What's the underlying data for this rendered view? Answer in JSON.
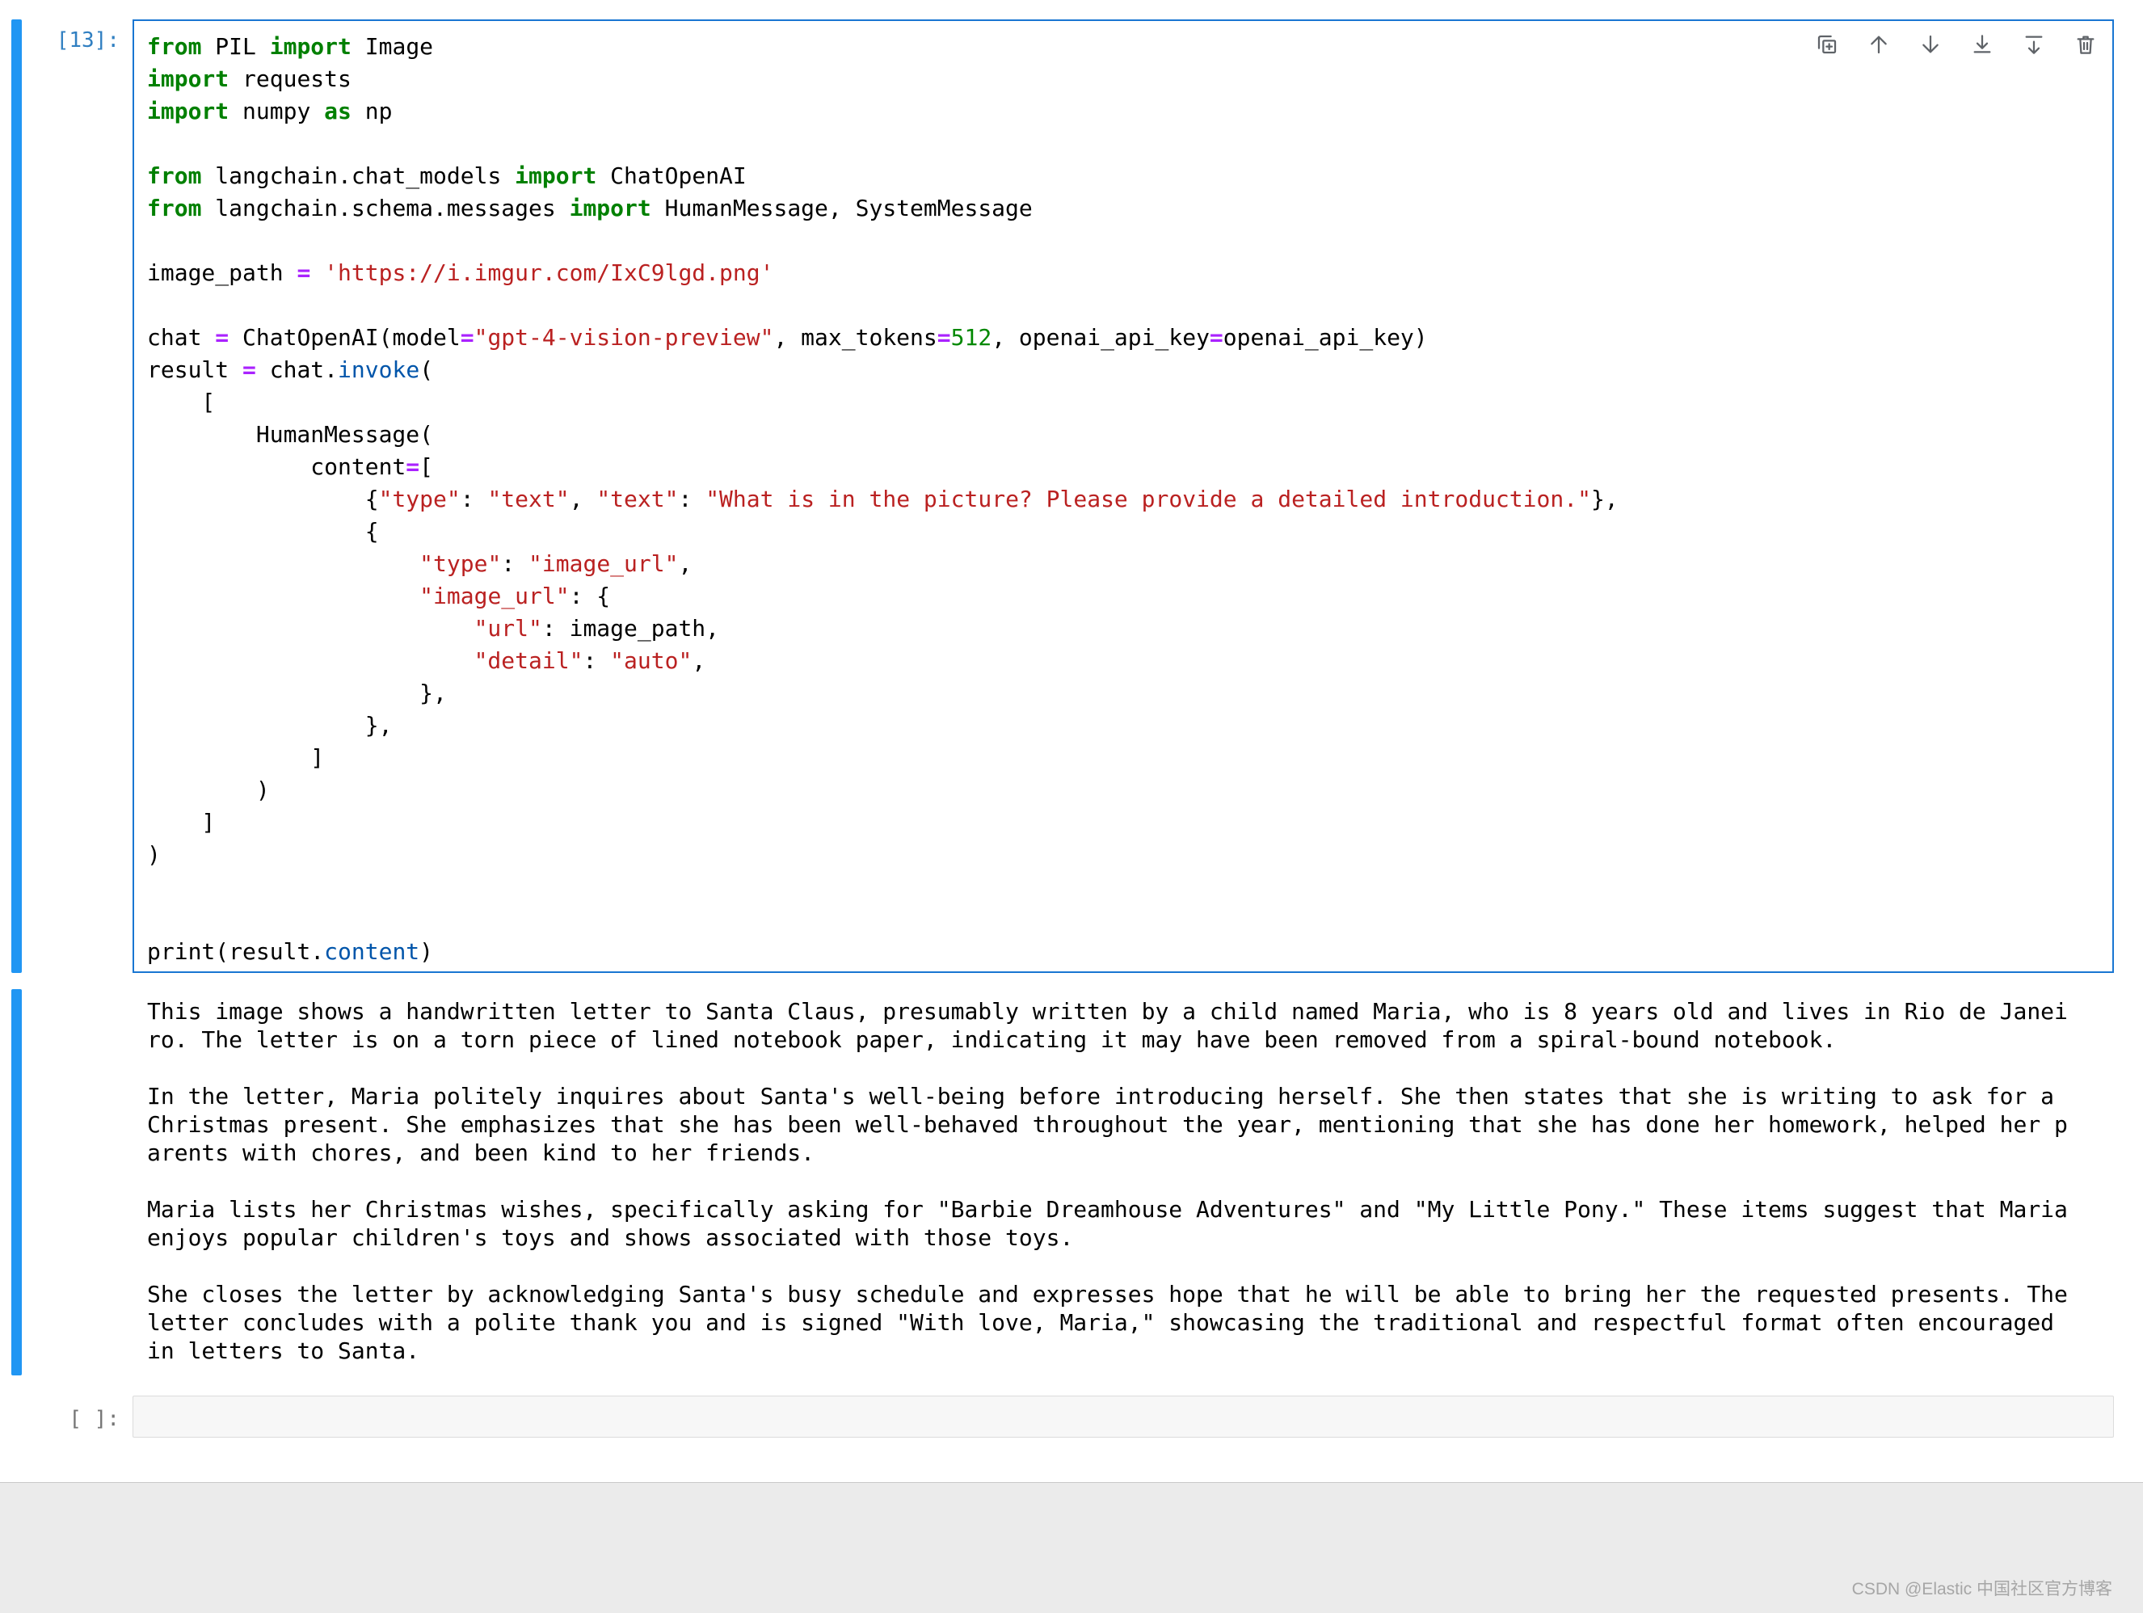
{
  "colors": {
    "accent_blue": "#1976d2",
    "collapser_blue": "#2196f3",
    "prompt_blue": "#307fc1",
    "keyword_green": "#008000",
    "operator_purple": "#AA22FF",
    "string_red": "#BA2121",
    "number_green": "#008800",
    "property_blue": "#0055aa"
  },
  "cell": {
    "prompt": "[13]:",
    "toolbar_icons": [
      "duplicate-cell",
      "move-cell-up",
      "move-cell-down",
      "insert-cell-above",
      "insert-cell-below",
      "delete-cell"
    ],
    "code_lines": [
      [
        [
          "k",
          "from"
        ],
        [
          "d",
          " PIL "
        ],
        [
          "k",
          "import"
        ],
        [
          "d",
          " Image"
        ]
      ],
      [
        [
          "k",
          "import"
        ],
        [
          "d",
          " requests"
        ]
      ],
      [
        [
          "k",
          "import"
        ],
        [
          "d",
          " numpy "
        ],
        [
          "k",
          "as"
        ],
        [
          "d",
          " np"
        ]
      ],
      [],
      [
        [
          "k",
          "from"
        ],
        [
          "d",
          " langchain.chat_models "
        ],
        [
          "k",
          "import"
        ],
        [
          "d",
          " ChatOpenAI"
        ]
      ],
      [
        [
          "k",
          "from"
        ],
        [
          "d",
          " langchain.schema.messages "
        ],
        [
          "k",
          "import"
        ],
        [
          "d",
          " HumanMessage, SystemMessage"
        ]
      ],
      [],
      [
        [
          "d",
          "image_path "
        ],
        [
          "o",
          "="
        ],
        [
          "d",
          " "
        ],
        [
          "s",
          "'https://i.imgur.com/IxC9lgd.png'"
        ]
      ],
      [],
      [
        [
          "d",
          "chat "
        ],
        [
          "o",
          "="
        ],
        [
          "d",
          " ChatOpenAI(model"
        ],
        [
          "o",
          "="
        ],
        [
          "s",
          "\"gpt-4-vision-preview\""
        ],
        [
          "d",
          ", max_tokens"
        ],
        [
          "o",
          "="
        ],
        [
          "n",
          "512"
        ],
        [
          "d",
          ", openai_api_key"
        ],
        [
          "o",
          "="
        ],
        [
          "d",
          "openai_api_key)"
        ]
      ],
      [
        [
          "d",
          "result "
        ],
        [
          "o",
          "="
        ],
        [
          "d",
          " chat."
        ],
        [
          "p",
          "invoke"
        ],
        [
          "d",
          "("
        ]
      ],
      [
        [
          "d",
          "    ["
        ]
      ],
      [
        [
          "d",
          "        HumanMessage("
        ]
      ],
      [
        [
          "d",
          "            content"
        ],
        [
          "o",
          "="
        ],
        [
          "d",
          "["
        ]
      ],
      [
        [
          "d",
          "                {"
        ],
        [
          "s",
          "\"type\""
        ],
        [
          "d",
          ": "
        ],
        [
          "s",
          "\"text\""
        ],
        [
          "d",
          ", "
        ],
        [
          "s",
          "\"text\""
        ],
        [
          "d",
          ": "
        ],
        [
          "s",
          "\"What is in the picture? Please provide a detailed introduction.\""
        ],
        [
          "d",
          "},"
        ]
      ],
      [
        [
          "d",
          "                {"
        ]
      ],
      [
        [
          "d",
          "                    "
        ],
        [
          "s",
          "\"type\""
        ],
        [
          "d",
          ": "
        ],
        [
          "s",
          "\"image_url\""
        ],
        [
          "d",
          ","
        ]
      ],
      [
        [
          "d",
          "                    "
        ],
        [
          "s",
          "\"image_url\""
        ],
        [
          "d",
          ": {"
        ]
      ],
      [
        [
          "d",
          "                        "
        ],
        [
          "s",
          "\"url\""
        ],
        [
          "d",
          ": image_path,"
        ]
      ],
      [
        [
          "d",
          "                        "
        ],
        [
          "s",
          "\"detail\""
        ],
        [
          "d",
          ": "
        ],
        [
          "s",
          "\"auto\""
        ],
        [
          "d",
          ","
        ]
      ],
      [
        [
          "d",
          "                    },"
        ]
      ],
      [
        [
          "d",
          "                },"
        ]
      ],
      [
        [
          "d",
          "            ]"
        ]
      ],
      [
        [
          "d",
          "        )"
        ]
      ],
      [
        [
          "d",
          "    ]"
        ]
      ],
      [
        [
          "d",
          ")"
        ]
      ],
      [],
      [],
      [
        [
          "d",
          "print(result."
        ],
        [
          "p",
          "content"
        ],
        [
          "d",
          ")"
        ]
      ]
    ],
    "output_paragraphs": [
      "This image shows a handwritten letter to Santa Claus, presumably written by a child named Maria, who is 8 years old and lives in Rio de Janeiro. The letter is on a torn piece of lined notebook paper, indicating it may have been removed from a spiral-bound notebook.",
      "In the letter, Maria politely inquires about Santa's well-being before introducing herself. She then states that she is writing to ask for a Christmas present. She emphasizes that she has been well-behaved throughout the year, mentioning that she has done her homework, helped her parents with chores, and been kind to her friends.",
      "Maria lists her Christmas wishes, specifically asking for \"Barbie Dreamhouse Adventures\" and \"My Little Pony.\" These items suggest that Maria enjoys popular children's toys and shows associated with those toys.",
      "She closes the letter by acknowledging Santa's busy schedule and expresses hope that he will be able to bring her the requested presents. The letter concludes with a polite thank you and is signed \"With love, Maria,\" showcasing the traditional and respectful format often encouraged in letters to Santa."
    ]
  },
  "empty_cell": {
    "prompt": "[ ]:"
  },
  "watermark": "CSDN @Elastic 中国社区官方博客"
}
